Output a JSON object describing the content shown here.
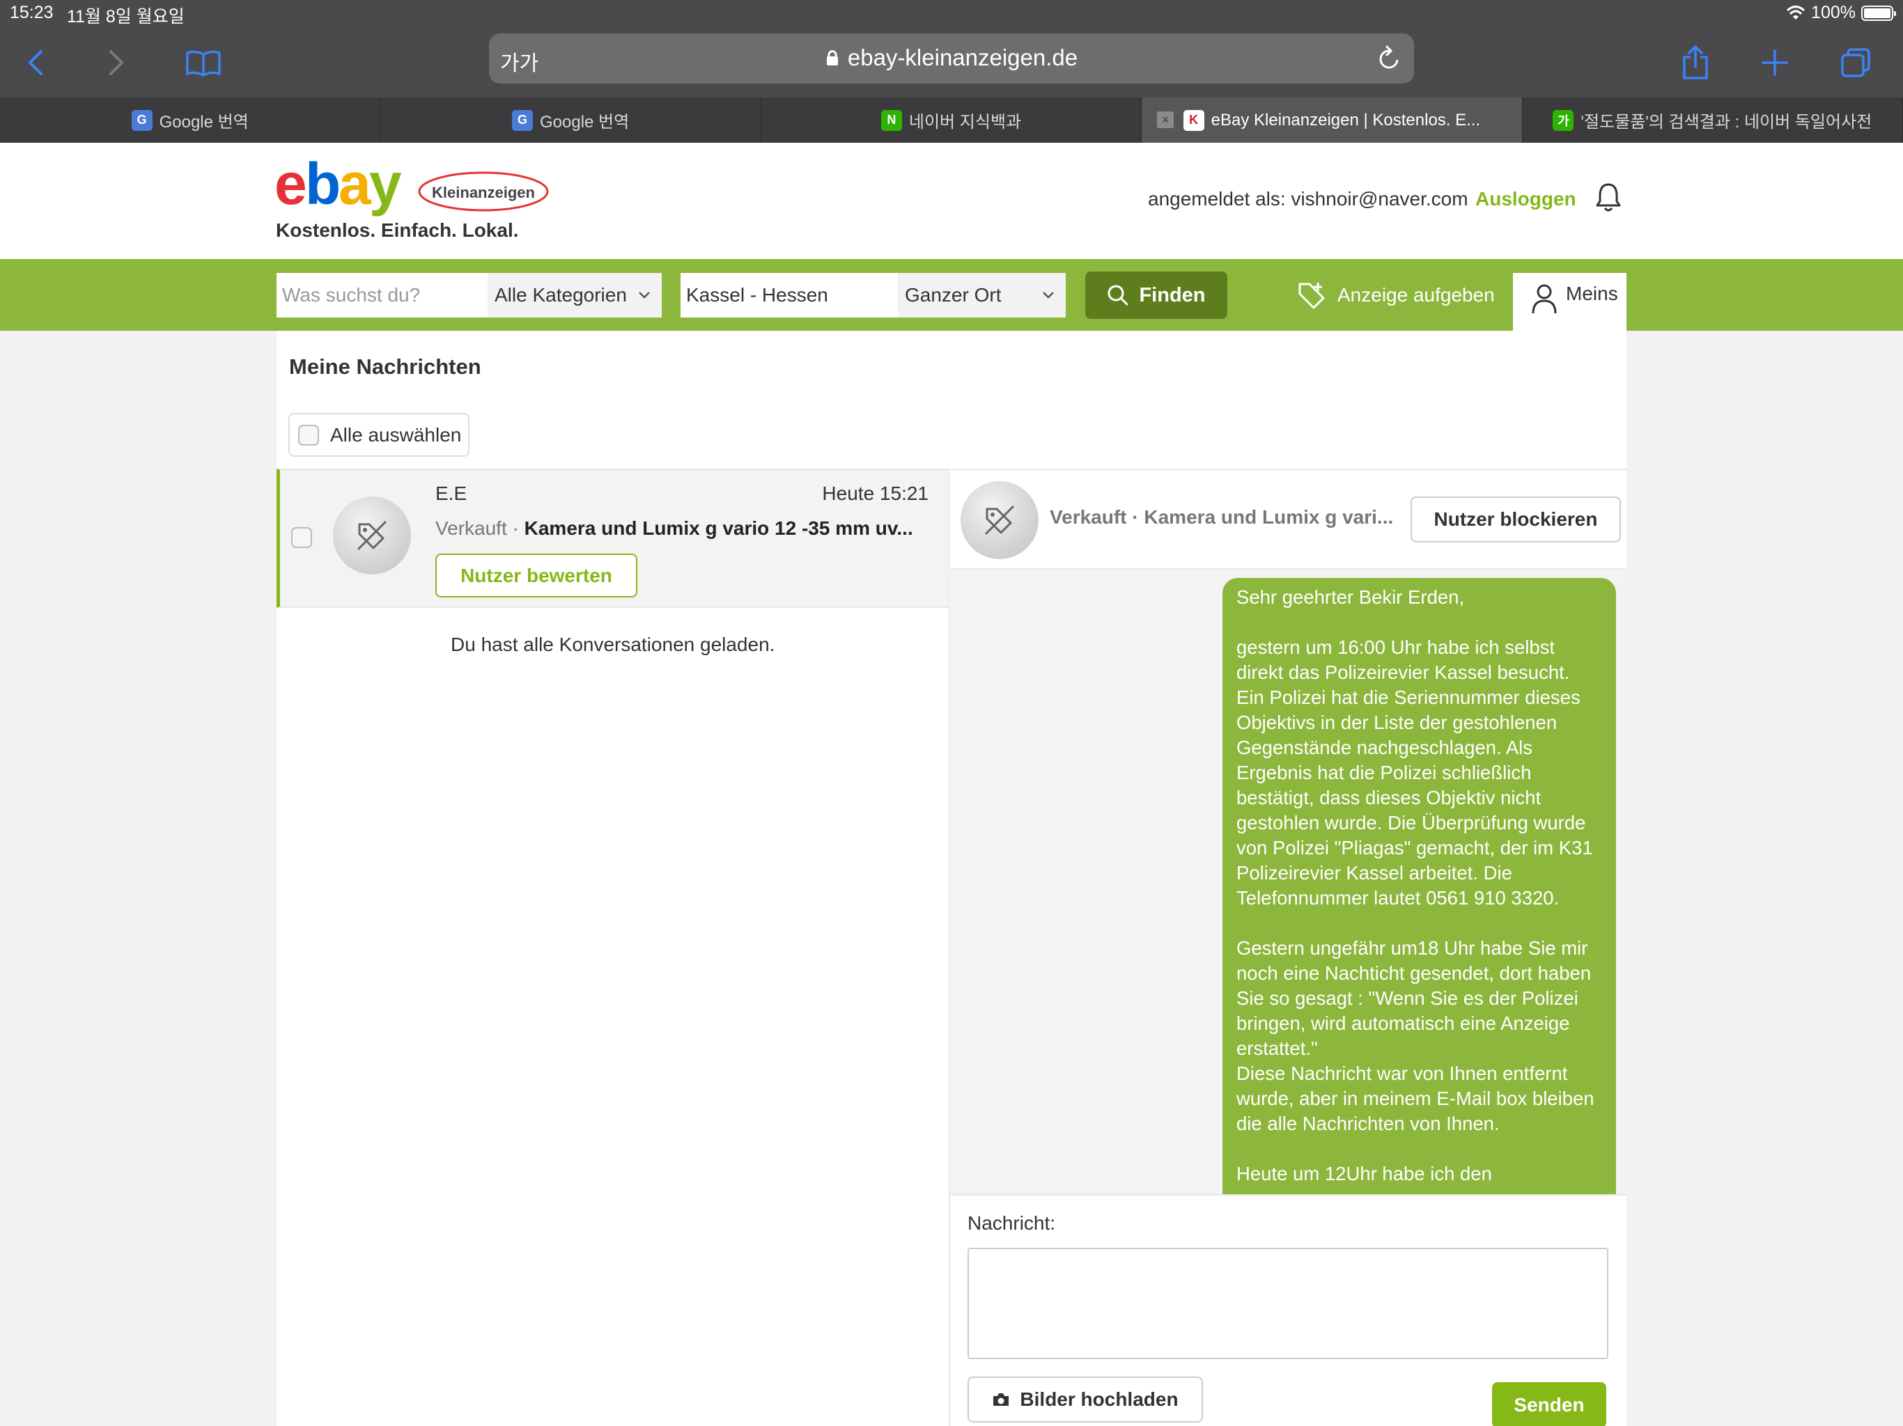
{
  "status": {
    "time": "15:23",
    "date": "11월 8일 월요일",
    "battery": "100%"
  },
  "browser": {
    "text_size_label": "가가",
    "url": "ebay-kleinanzeigen.de",
    "tabs": [
      {
        "label": "Google 번역",
        "favicon": "google-translate-icon",
        "color": "#4a7bd8"
      },
      {
        "label": "Google 번역",
        "favicon": "google-translate-icon",
        "color": "#4a7bd8"
      },
      {
        "label": "네이버 지식백과",
        "favicon": "naver-icon",
        "color": "#2db400"
      },
      {
        "label": "eBay Kleinanzeigen | Kostenlos. E...",
        "favicon": "kleinanzeigen-icon",
        "color": "#ffffff"
      },
      {
        "label": "'절도물품'의 검색결과 : 네이버 독일어사전",
        "favicon": "naver-dict-icon",
        "color": "#2db400"
      }
    ]
  },
  "header": {
    "logo_sub": "Kleinanzeigen",
    "tagline": "Kostenlos. Einfach. Lokal.",
    "login_label": "angemeldet als: vishnoir@naver.com",
    "logout_label": "Ausloggen"
  },
  "search": {
    "query_placeholder": "Was suchst du?",
    "category": "Alle Kategorien",
    "location": "Kassel - Hessen",
    "radius": "Ganzer Ort",
    "find_label": "Finden",
    "post_ad_label": "Anzeige aufgeben",
    "meins_label": "Meins"
  },
  "messages": {
    "title": "Meine Nachrichten",
    "select_all_label": "Alle auswählen",
    "conversation": {
      "name": "E.E",
      "time": "Heute 15:21",
      "type": "Verkauft",
      "separator": " · ",
      "subject": "Kamera und Lumix g vario 12 -35 mm uv...",
      "rate_label": "Nutzer bewerten"
    },
    "loaded_note": "Du hast alle Konversationen geladen.",
    "chat": {
      "type": "Verkauft",
      "separator": " · ",
      "subject": "Kamera und Lumix g vari...",
      "block_label": "Nutzer blockieren",
      "message": "Sehr geehrter Bekir Erden,\n\ngestern um 16:00 Uhr habe ich selbst direkt das Polizeirevier Kassel besucht. Ein Polizei hat die Seriennummer dieses Objektivs in der Liste der gestohlenen Gegenstände nachgeschlagen. Als Ergebnis hat die Polizei schließlich bestätigt, dass dieses Objektiv nicht gestohlen wurde. Die Überprüfung wurde von Polizei \"Pliagas\" gemacht, der im K31 Polizeirevier Kassel arbeitet. Die Telefonnummer lautet 0561 910 3320.\n\nGestern ungefähr um18 Uhr habe Sie mir noch eine Nachticht gesendet, dort haben Sie so gesagt : \"Wenn Sie es der Polizei bringen, wird automatisch eine Anzeige erstattet.\"\nDiese Nachricht war von Ihnen entfernt wurde, aber in meinem E-Mail box bleiben die alle Nachrichten von Ihnen.\n\nHeute um 12Uhr habe ich den",
      "compose_label": "Nachricht:",
      "compose_value": "",
      "upload_label": "Bilder hochladen",
      "send_label": "Senden"
    }
  },
  "colors": {
    "brand_green": "#86b817",
    "bar_green": "#8cb63c",
    "find_button": "#5e7e1e",
    "chrome_dark": "#4a4a4c"
  }
}
